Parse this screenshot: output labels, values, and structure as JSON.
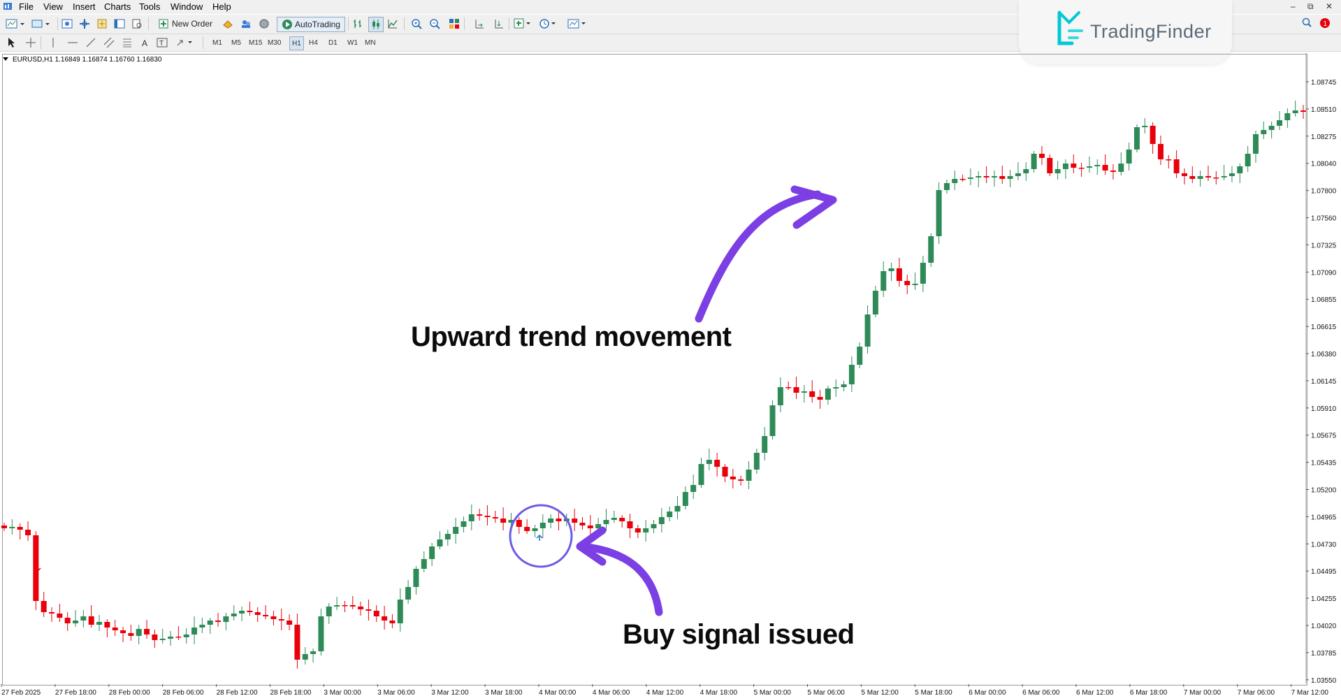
{
  "menu": [
    "File",
    "View",
    "Insert",
    "Charts",
    "Tools",
    "Window",
    "Help"
  ],
  "toolbar": {
    "new_order_label": "New Order",
    "autotrading_label": "AutoTrading",
    "timeframes": [
      "M1",
      "M5",
      "M15",
      "M30",
      "H1",
      "H4",
      "D1",
      "W1",
      "MN"
    ]
  },
  "logo": {
    "text": "TradingFinder",
    "color": "#00c8d7"
  },
  "chart": {
    "symbol_line": "EURUSD,H1  1.16849 1.16874 1.16760 1.16830",
    "price_axis": [
      "1.08745",
      "1.08510",
      "1.08275",
      "1.08040",
      "1.07800",
      "1.07560",
      "1.07325",
      "1.07090",
      "1.06855",
      "1.06615",
      "1.06380",
      "1.06145",
      "1.05910",
      "1.05675",
      "1.05435",
      "1.05200",
      "1.04965",
      "1.04730",
      "1.04495",
      "1.04255",
      "1.04020",
      "1.03785",
      "1.03550"
    ],
    "time_axis": [
      "27 Feb 2025",
      "27 Feb 18:00",
      "28 Feb 00:00",
      "28 Feb 06:00",
      "28 Feb 12:00",
      "28 Feb 18:00",
      "3 Mar 00:00",
      "3 Mar 06:00",
      "3 Mar 12:00",
      "3 Mar 18:00",
      "4 Mar 00:00",
      "4 Mar 06:00",
      "4 Mar 12:00",
      "4 Mar 18:00",
      "5 Mar 00:00",
      "5 Mar 06:00",
      "5 Mar 12:00",
      "5 Mar 18:00",
      "6 Mar 00:00",
      "6 Mar 06:00",
      "6 Mar 12:00",
      "6 Mar 18:00",
      "7 Mar 00:00",
      "7 Mar 06:00",
      "7 Mar 12:00"
    ],
    "colors": {
      "bull": "#2e8b57",
      "bear": "#e8000b",
      "arrow": "#7b3fe4",
      "circle": "#6a5acd"
    }
  },
  "annotations": {
    "trend": "Upward trend movement",
    "signal": "Buy signal issued"
  }
}
